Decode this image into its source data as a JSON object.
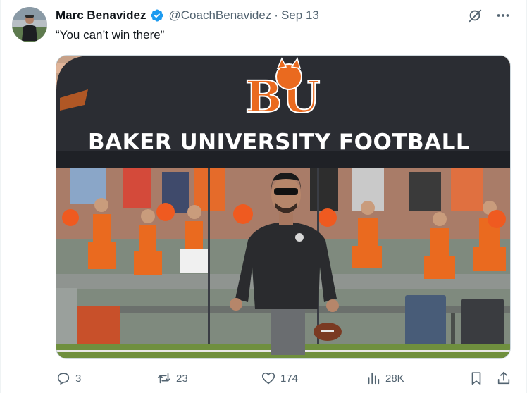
{
  "tweet": {
    "author_name": "Marc Benavidez",
    "handle": "@CoachBenavidez",
    "separator": "·",
    "date": "Sep 13",
    "text": "“You can’t win there”"
  },
  "media": {
    "tent_banner_text": "BAKER UNIVERSITY FOOTBALL",
    "tent_logo_text": "BU",
    "brand_orange": "#ea6a1f",
    "tent_color": "#2b2d33"
  },
  "actions": {
    "replies": "3",
    "reposts": "23",
    "likes": "174",
    "views": "28K"
  },
  "colors": {
    "verified_blue": "#1d9bf0",
    "secondary_text": "#536471"
  },
  "icons": {
    "verified": "verified-badge-icon",
    "grok": "grok-icon",
    "more": "more-icon",
    "reply": "reply-icon",
    "repost": "repost-icon",
    "like": "like-icon",
    "views": "views-icon",
    "bookmark": "bookmark-icon",
    "share": "share-icon"
  }
}
